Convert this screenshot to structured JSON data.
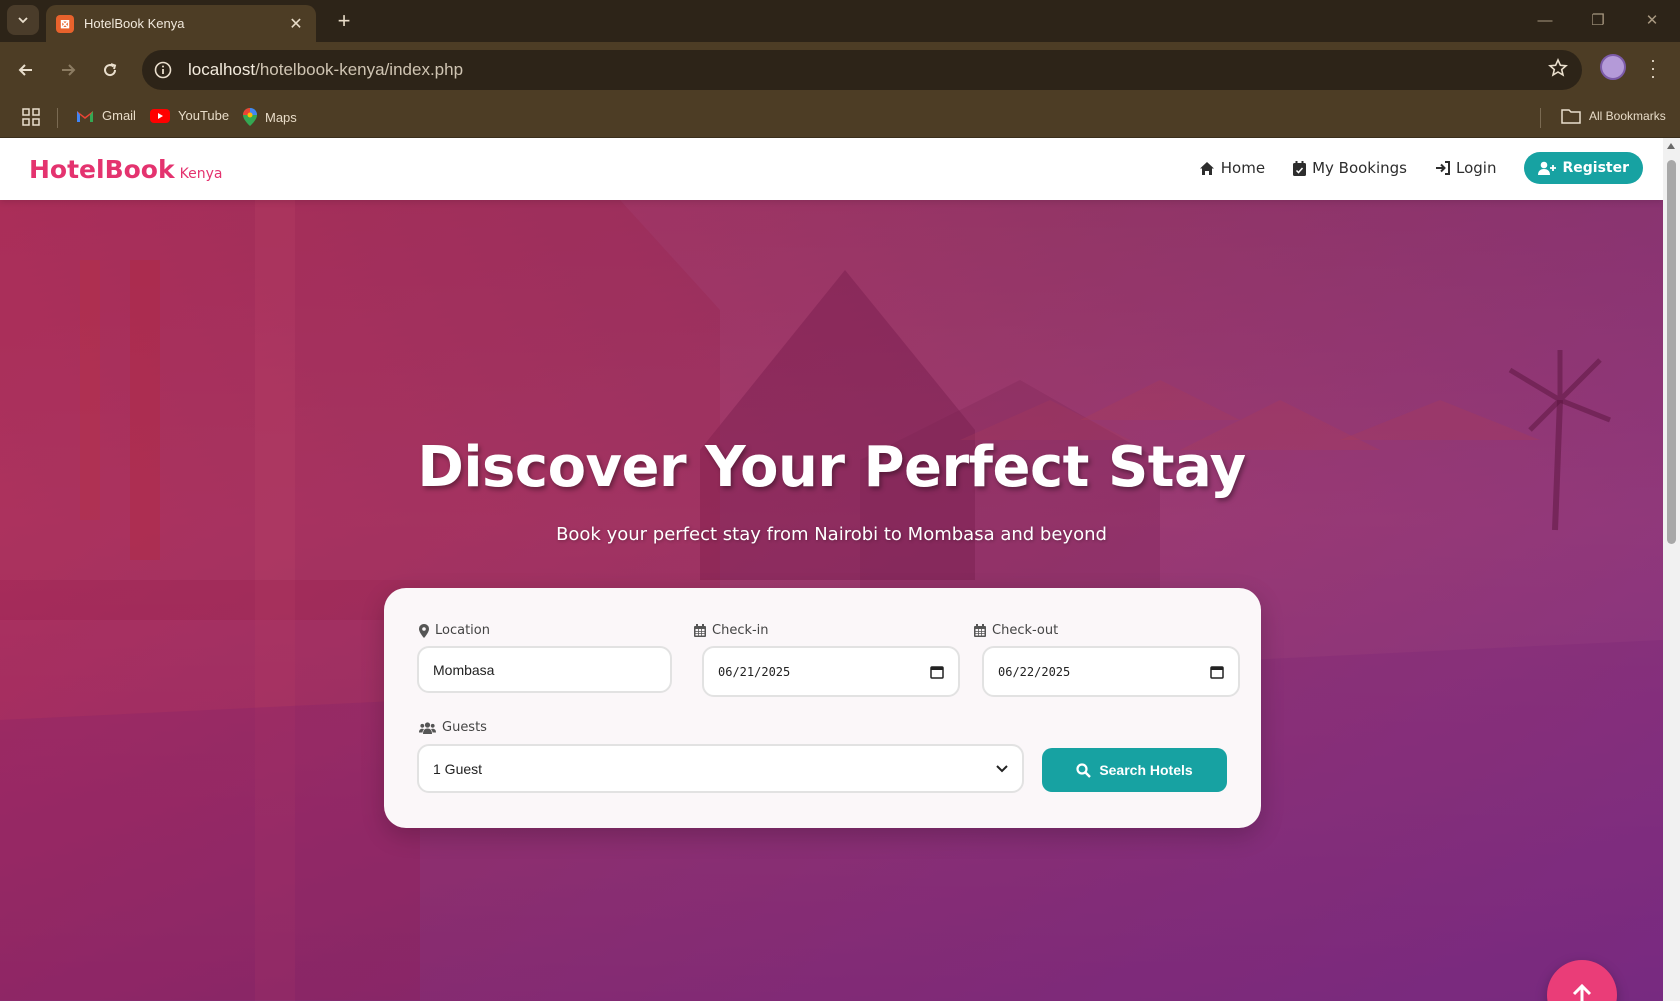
{
  "browser": {
    "tab_title": "HotelBook Kenya",
    "url_host": "localhost",
    "url_path": "/hotelbook-kenya/index.php",
    "bookmarks": [
      {
        "label": "Gmail",
        "icon": "gmail-icon"
      },
      {
        "label": "YouTube",
        "icon": "youtube-icon"
      },
      {
        "label": "Maps",
        "icon": "maps-icon"
      }
    ],
    "all_bookmarks_label": "All Bookmarks"
  },
  "navbar": {
    "brand": "HotelBook",
    "brand_sub": "Kenya",
    "links": {
      "home": "Home",
      "bookings": "My Bookings",
      "login": "Login",
      "register": "Register"
    }
  },
  "hero": {
    "title": "Discover Your Perfect Stay",
    "subtitle": "Book your perfect stay from Nairobi to Mombasa and beyond"
  },
  "search": {
    "location_label": "Location",
    "location_value": "Mombasa",
    "checkin_label": "Check-in",
    "checkin_value": "06/21/2025",
    "checkout_label": "Check-out",
    "checkout_value": "06/22/2025",
    "guests_label": "Guests",
    "guests_value": "1 Guest",
    "button_label": "Search Hotels"
  },
  "colors": {
    "brand": "#e4336f",
    "accent": "#17a2a2",
    "fab": "#ea3d78"
  }
}
